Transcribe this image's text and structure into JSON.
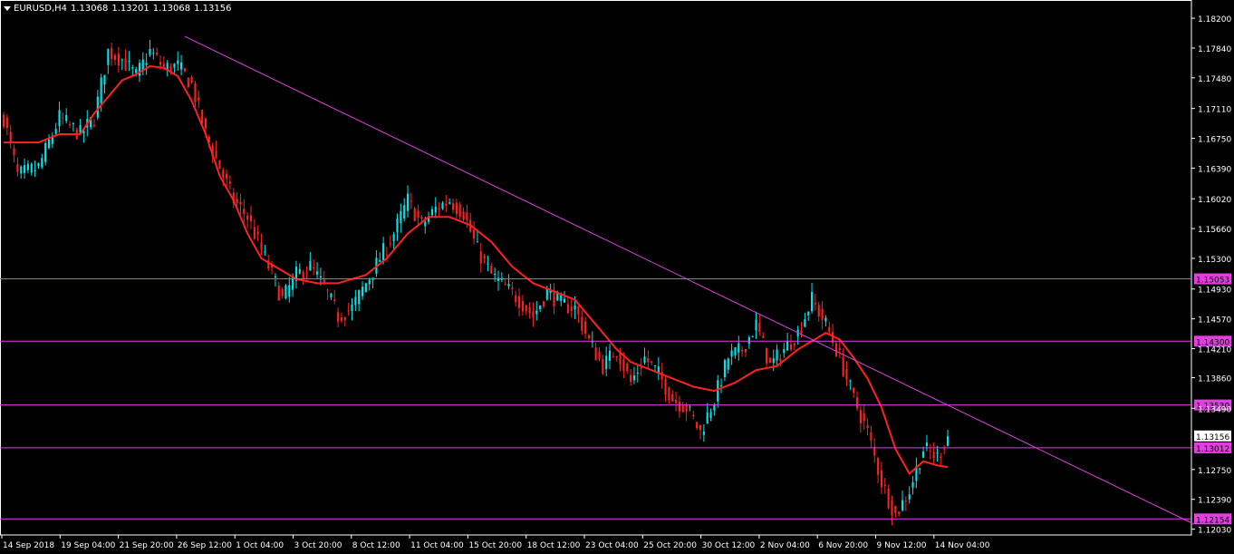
{
  "header": {
    "symbol": "EURUSD,H4",
    "open": "1.13068",
    "high": "1.13201",
    "low": "1.13068",
    "close": "1.13156"
  },
  "colors": {
    "background": "#000000",
    "bull_candle": "#00e5ee",
    "bear_candle": "#ff2020",
    "moving_average": "#ff2020",
    "trend_lines": "#e040e0",
    "axis": "#ffffff",
    "current_price_box": "#ffffff",
    "level_box": "#e040e0"
  },
  "chart_data": {
    "type": "candlestick",
    "symbol": "EURUSD",
    "timeframe": "H4",
    "ylim": [
      1.1196,
      1.1842
    ],
    "y_ticks": [
      "1.18200",
      "1.17840",
      "1.17480",
      "1.17110",
      "1.16750",
      "1.16390",
      "1.16020",
      "1.15660",
      "1.15300",
      "1.14930",
      "1.14570",
      "1.14210",
      "1.13860",
      "1.13490",
      "1.12750",
      "1.12390",
      "1.12030"
    ],
    "x_ticks": [
      "14 Sep 2018",
      "19 Sep 04:00",
      "21 Sep 20:00",
      "26 Sep 12:00",
      "1 Oct 04:00",
      "3 Oct 20:00",
      "8 Oct 12:00",
      "11 Oct 04:00",
      "15 Oct 20:00",
      "18 Oct 12:00",
      "23 Oct 04:00",
      "25 Oct 20:00",
      "30 Oct 12:00",
      "2 Nov 04:00",
      "6 Nov 20:00",
      "9 Nov 12:00",
      "14 Nov 04:00"
    ],
    "horizontal_levels": [
      "1.15053",
      "1.14300",
      "1.13530",
      "1.13012",
      "1.12154"
    ],
    "current_price": "1.13156",
    "trendline": {
      "start": {
        "time": "26 Sep 2018",
        "price": 1.1798
      },
      "end": {
        "time": "19 Nov 2018",
        "price": 1.1209
      }
    },
    "price_path": [
      [
        0,
        1.17
      ],
      [
        4,
        1.163
      ],
      [
        10,
        1.164
      ],
      [
        16,
        1.17
      ],
      [
        22,
        1.168
      ],
      [
        26,
        1.17
      ],
      [
        30,
        1.178
      ],
      [
        34,
        1.177
      ],
      [
        38,
        1.175
      ],
      [
        42,
        1.178
      ],
      [
        46,
        1.176
      ],
      [
        50,
        1.1762
      ],
      [
        54,
        1.174
      ],
      [
        58,
        1.168
      ],
      [
        62,
        1.164
      ],
      [
        66,
        1.16
      ],
      [
        70,
        1.158
      ],
      [
        74,
        1.154
      ],
      [
        76,
        1.152
      ],
      [
        80,
        1.148
      ],
      [
        84,
        1.151
      ],
      [
        88,
        1.152
      ],
      [
        92,
        1.1495
      ],
      [
        96,
        1.146
      ],
      [
        100,
        1.147
      ],
      [
        104,
        1.15
      ],
      [
        108,
        1.153
      ],
      [
        112,
        1.156
      ],
      [
        116,
        1.16
      ],
      [
        120,
        1.157
      ],
      [
        124,
        1.159
      ],
      [
        128,
        1.16
      ],
      [
        132,
        1.1585
      ],
      [
        136,
        1.154
      ],
      [
        140,
        1.151
      ],
      [
        144,
        1.1495
      ],
      [
        148,
        1.148
      ],
      [
        152,
        1.146
      ],
      [
        156,
        1.149
      ],
      [
        160,
        1.1475
      ],
      [
        164,
        1.147
      ],
      [
        168,
        1.143
      ],
      [
        172,
        1.14
      ],
      [
        176,
        1.142
      ],
      [
        180,
        1.138
      ],
      [
        184,
        1.141
      ],
      [
        188,
        1.139
      ],
      [
        192,
        1.136
      ],
      [
        196,
        1.135
      ],
      [
        200,
        1.132
      ],
      [
        204,
        1.136
      ],
      [
        208,
        1.141
      ],
      [
        212,
        1.142
      ],
      [
        216,
        1.145
      ],
      [
        220,
        1.14
      ],
      [
        224,
        1.142
      ],
      [
        228,
        1.144
      ],
      [
        232,
        1.148
      ],
      [
        236,
        1.145
      ],
      [
        240,
        1.141
      ],
      [
        244,
        1.136
      ],
      [
        248,
        1.132
      ],
      [
        252,
        1.126
      ],
      [
        256,
        1.122
      ],
      [
        260,
        1.125
      ],
      [
        264,
        1.13
      ],
      [
        268,
        1.129
      ],
      [
        271,
        1.1316
      ]
    ],
    "moving_average": [
      [
        0,
        1.167
      ],
      [
        10,
        1.167
      ],
      [
        16,
        1.168
      ],
      [
        22,
        1.168
      ],
      [
        26,
        1.1705
      ],
      [
        30,
        1.1725
      ],
      [
        34,
        1.1745
      ],
      [
        38,
        1.1752
      ],
      [
        42,
        1.1762
      ],
      [
        46,
        1.176
      ],
      [
        50,
        1.175
      ],
      [
        54,
        1.172
      ],
      [
        58,
        1.168
      ],
      [
        62,
        1.163
      ],
      [
        66,
        1.16
      ],
      [
        70,
        1.156
      ],
      [
        74,
        1.153
      ],
      [
        78,
        1.152
      ],
      [
        84,
        1.1505
      ],
      [
        90,
        1.15
      ],
      [
        96,
        1.15
      ],
      [
        104,
        1.151
      ],
      [
        110,
        1.153
      ],
      [
        116,
        1.156
      ],
      [
        122,
        1.158
      ],
      [
        128,
        1.158
      ],
      [
        134,
        1.157
      ],
      [
        140,
        1.155
      ],
      [
        146,
        1.152
      ],
      [
        152,
        1.15
      ],
      [
        158,
        1.149
      ],
      [
        164,
        1.148
      ],
      [
        168,
        1.146
      ],
      [
        172,
        1.144
      ],
      [
        176,
        1.142
      ],
      [
        180,
        1.1405
      ],
      [
        186,
        1.1395
      ],
      [
        192,
        1.1385
      ],
      [
        198,
        1.1375
      ],
      [
        204,
        1.137
      ],
      [
        210,
        1.138
      ],
      [
        216,
        1.1395
      ],
      [
        222,
        1.14
      ],
      [
        228,
        1.142
      ],
      [
        232,
        1.143
      ],
      [
        236,
        1.144
      ],
      [
        240,
        1.1432
      ],
      [
        244,
        1.141
      ],
      [
        248,
        1.1385
      ],
      [
        252,
        1.135
      ],
      [
        256,
        1.13
      ],
      [
        260,
        1.127
      ],
      [
        264,
        1.1285
      ],
      [
        268,
        1.128
      ],
      [
        271,
        1.1278
      ]
    ],
    "num_bars": 272
  }
}
